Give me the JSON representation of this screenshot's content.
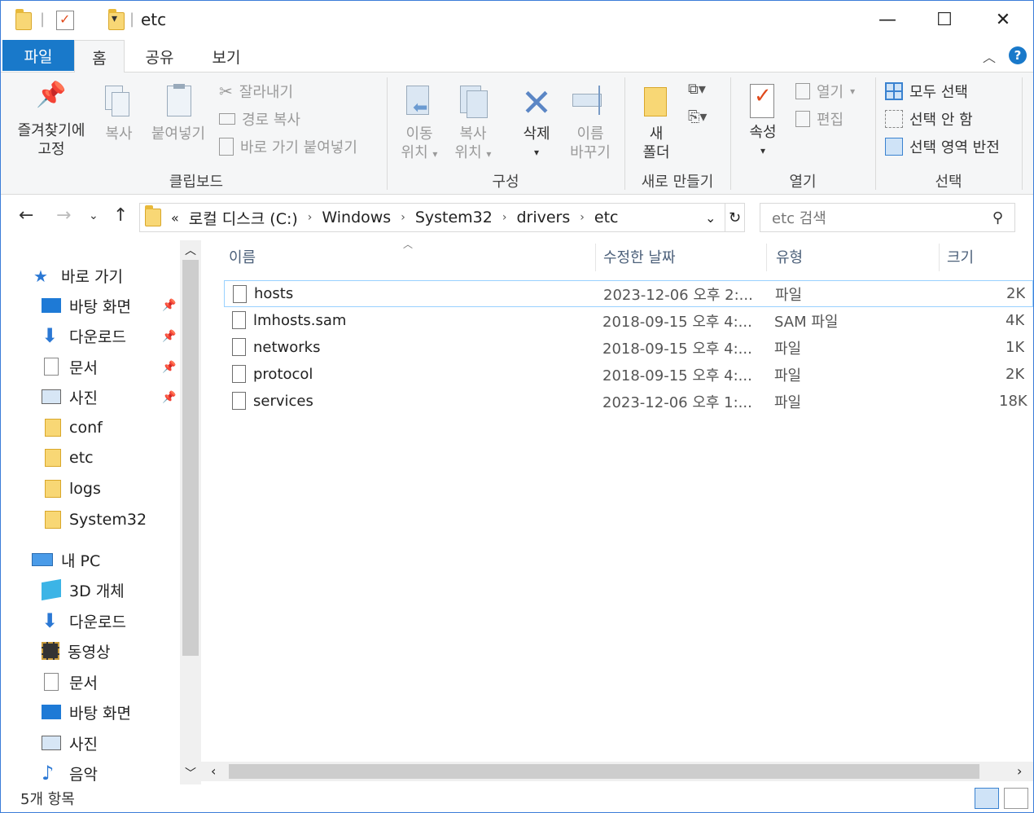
{
  "window": {
    "title": "etc",
    "minimize": "—",
    "maximize": "☐",
    "close": "✕"
  },
  "tabs": {
    "file": "파일",
    "home": "홈",
    "share": "공유",
    "view": "보기"
  },
  "ribbon": {
    "pin_label_1": "즐겨찾기에",
    "pin_label_2": "고정",
    "copy": "복사",
    "paste": "붙여넣기",
    "cut": "잘라내기",
    "copy_path": "경로 복사",
    "paste_shortcut": "바로 가기 붙여넣기",
    "group_clipboard": "클립보드",
    "move_to_1": "이동",
    "move_to_2": "위치",
    "copy_to_1": "복사",
    "copy_to_2": "위치",
    "delete": "삭제",
    "rename_1": "이름",
    "rename_2": "바꾸기",
    "group_organize": "구성",
    "new_folder_1": "새",
    "new_folder_2": "폴더",
    "group_new": "새로 만들기",
    "properties": "속성",
    "open": "열기",
    "edit": "편집",
    "group_open": "열기",
    "select_all": "모두 선택",
    "select_none": "선택 안 함",
    "invert_selection": "선택 영역 반전",
    "group_select": "선택"
  },
  "address": {
    "prefix": "«",
    "crumbs": [
      "로컬 디스크 (C:)",
      "Windows",
      "System32",
      "drivers",
      "etc"
    ],
    "search_placeholder": "etc 검색"
  },
  "nav": {
    "quick_access": "바로 가기",
    "quick_items": [
      "바탕 화면",
      "다운로드",
      "문서",
      "사진",
      "conf",
      "etc",
      "logs",
      "System32"
    ],
    "this_pc": "내 PC",
    "pc_items": [
      "3D 개체",
      "다운로드",
      "동영상",
      "문서",
      "바탕 화면",
      "사진",
      "음악"
    ]
  },
  "columns": {
    "name": "이름",
    "date": "수정한 날짜",
    "type": "유형",
    "size": "크기"
  },
  "files": [
    {
      "name": "hosts",
      "date": "2023-12-06 오후 2:...",
      "type": "파일",
      "size": "2K"
    },
    {
      "name": "lmhosts.sam",
      "date": "2018-09-15 오후 4:...",
      "type": "SAM 파일",
      "size": "4K"
    },
    {
      "name": "networks",
      "date": "2018-09-15 오후 4:...",
      "type": "파일",
      "size": "1K"
    },
    {
      "name": "protocol",
      "date": "2018-09-15 오후 4:...",
      "type": "파일",
      "size": "2K"
    },
    {
      "name": "services",
      "date": "2023-12-06 오후 1:...",
      "type": "파일",
      "size": "18K"
    }
  ],
  "status": {
    "item_count": "5개 항목"
  },
  "colors": {
    "accent": "#1979ca",
    "folder": "#f8d775",
    "selection_border": "#99d1ff"
  }
}
